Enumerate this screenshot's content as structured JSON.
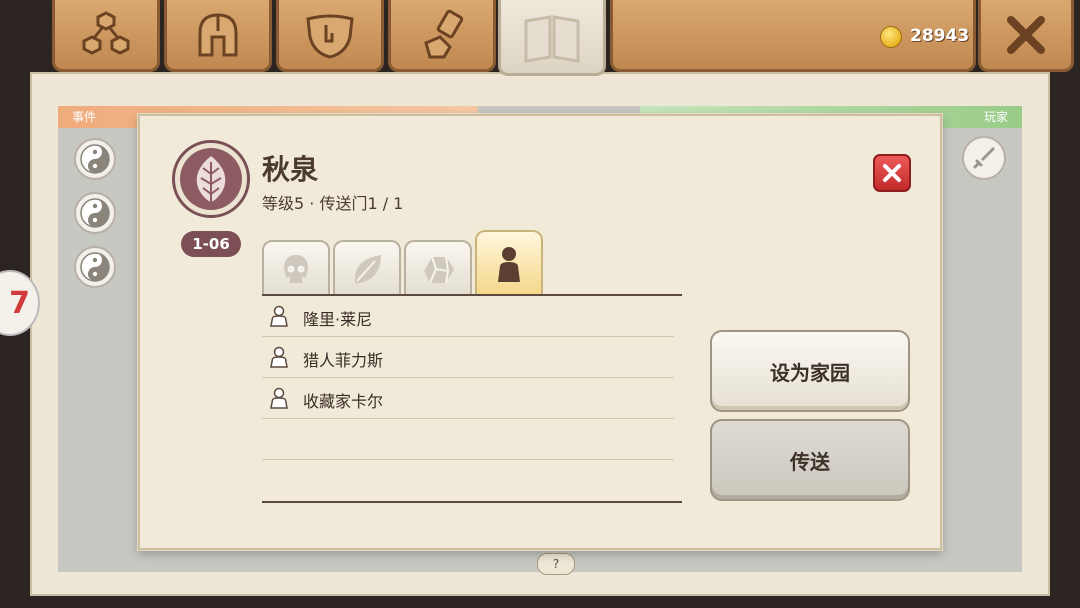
{
  "top_tabs": [
    {
      "name": "network"
    },
    {
      "name": "helmet"
    },
    {
      "name": "shield"
    },
    {
      "name": "craft"
    },
    {
      "name": "map",
      "active": true
    }
  ],
  "currency": {
    "amount": "28943",
    "icon": "gold-coin-icon"
  },
  "background": {
    "left_header": "事件",
    "right_header": "玩家",
    "side_badge": "7",
    "help": "?"
  },
  "dialog": {
    "title": "秋泉",
    "subtitle": "等级5 · 传送门1 / 1",
    "level_badge": "1-06",
    "tabs": [
      {
        "icon": "skull-icon"
      },
      {
        "icon": "leaf-icon"
      },
      {
        "icon": "ore-icon"
      },
      {
        "icon": "person-icon",
        "active": true
      }
    ],
    "npcs": [
      "隆里·莱尼",
      "猎人菲力斯",
      "收藏家卡尔"
    ],
    "buttons": {
      "set_home": "设为家园",
      "teleport": "传送"
    }
  },
  "colors": {
    "accent_wood": "#c08850",
    "badge": "#7c4f55",
    "close_red": "#d23b3b"
  }
}
